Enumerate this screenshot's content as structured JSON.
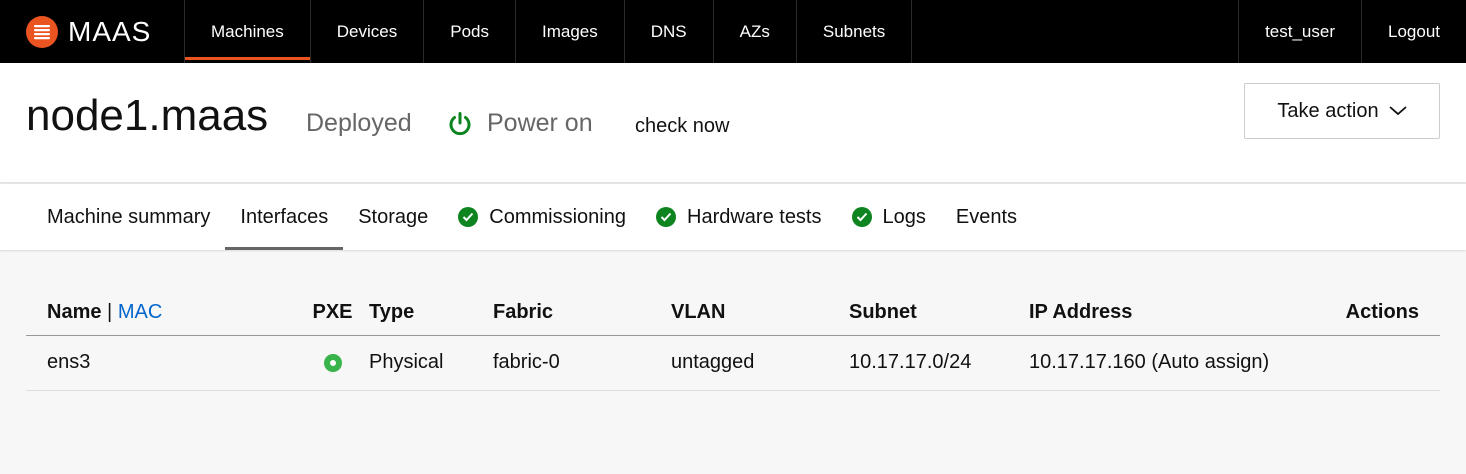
{
  "brand": {
    "name": "MAAS",
    "logo_icon": "maas-logo-icon",
    "logo_color": "#e95420"
  },
  "nav": {
    "items": [
      {
        "label": "Machines",
        "active": true
      },
      {
        "label": "Devices"
      },
      {
        "label": "Pods"
      },
      {
        "label": "Images"
      },
      {
        "label": "DNS"
      },
      {
        "label": "AZs"
      },
      {
        "label": "Subnets"
      }
    ],
    "user": "test_user",
    "logout": "Logout"
  },
  "header": {
    "title": "node1.maas",
    "status": "Deployed",
    "power_label": "Power on",
    "power_icon": "power-icon",
    "power_color": "#0e8420",
    "check_now": "check now",
    "take_action": "Take action"
  },
  "tabs": [
    {
      "label": "Machine summary",
      "check": false
    },
    {
      "label": "Interfaces",
      "active": true,
      "check": false
    },
    {
      "label": "Storage",
      "check": false
    },
    {
      "label": "Commissioning",
      "check": true
    },
    {
      "label": "Hardware tests",
      "check": true
    },
    {
      "label": "Logs",
      "check": true
    },
    {
      "label": "Events",
      "check": false
    }
  ],
  "table": {
    "headers": {
      "name": "Name",
      "separator": "|",
      "mac": "MAC",
      "pxe": "PXE",
      "type": "Type",
      "fabric": "Fabric",
      "vlan": "VLAN",
      "subnet": "Subnet",
      "ip": "IP Address",
      "actions": "Actions"
    },
    "rows": [
      {
        "name": "ens3",
        "pxe": true,
        "type": "Physical",
        "fabric": "fabric-0",
        "vlan": "untagged",
        "subnet": "10.17.17.0/24",
        "ip": "10.17.17.160 (Auto assign)"
      }
    ]
  }
}
